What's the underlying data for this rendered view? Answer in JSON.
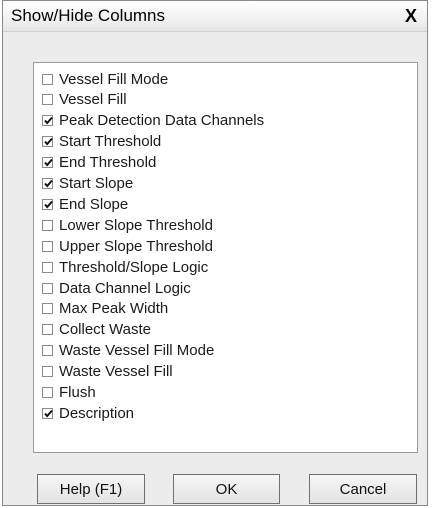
{
  "window": {
    "title": "Show/Hide Columns",
    "close_glyph": "X"
  },
  "columns": [
    {
      "label": "Vessel Fill Mode",
      "checked": false
    },
    {
      "label": "Vessel Fill",
      "checked": false
    },
    {
      "label": "Peak Detection Data Channels",
      "checked": true
    },
    {
      "label": "Start Threshold",
      "checked": true
    },
    {
      "label": "End Threshold",
      "checked": true
    },
    {
      "label": "Start Slope",
      "checked": true
    },
    {
      "label": "End Slope",
      "checked": true
    },
    {
      "label": "Lower Slope Threshold",
      "checked": false
    },
    {
      "label": "Upper Slope Threshold",
      "checked": false
    },
    {
      "label": "Threshold/Slope Logic",
      "checked": false
    },
    {
      "label": "Data Channel Logic",
      "checked": false
    },
    {
      "label": "Max Peak Width",
      "checked": false
    },
    {
      "label": "Collect Waste",
      "checked": false
    },
    {
      "label": "Waste Vessel Fill Mode",
      "checked": false
    },
    {
      "label": "Waste Vessel Fill",
      "checked": false
    },
    {
      "label": "Flush",
      "checked": false
    },
    {
      "label": "Description",
      "checked": true
    }
  ],
  "buttons": {
    "help": "Help (F1)",
    "ok": "OK",
    "cancel": "Cancel"
  }
}
